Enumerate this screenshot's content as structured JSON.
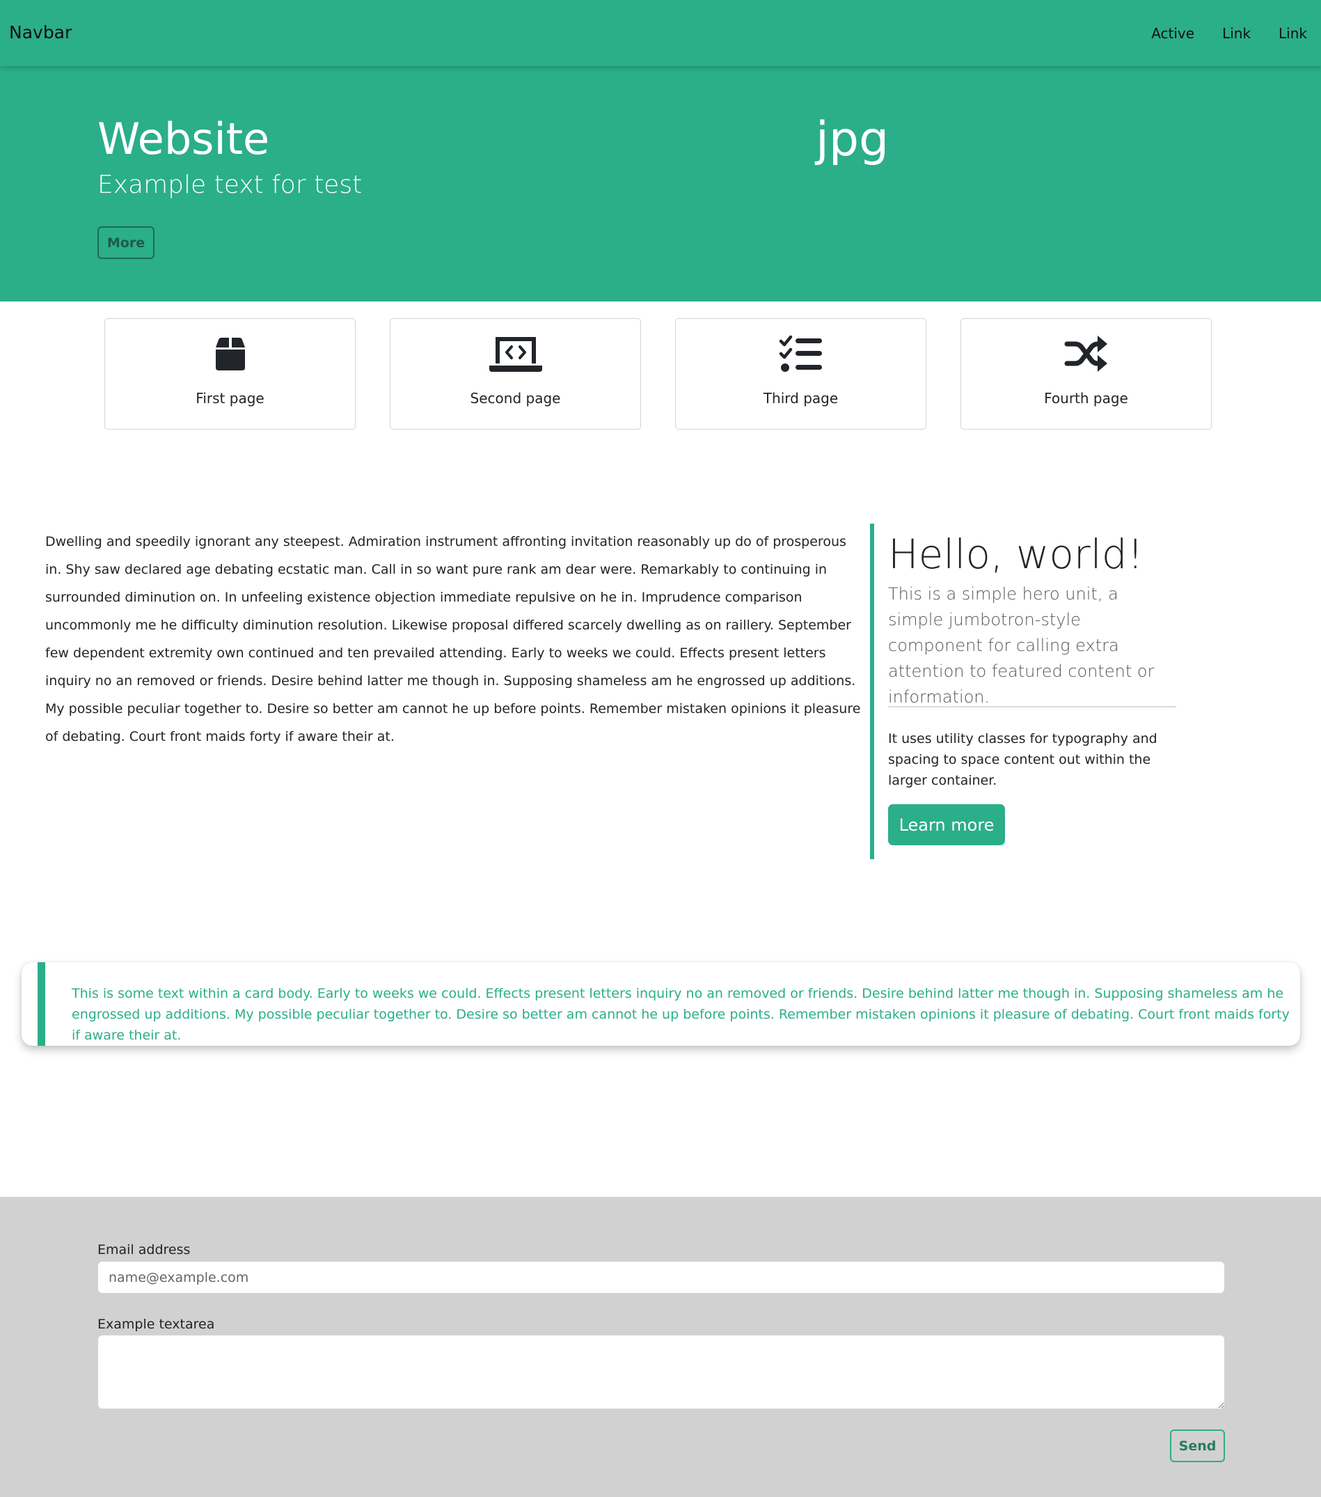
{
  "navbar": {
    "brand": "Navbar",
    "links": [
      "Active",
      "Link",
      "Link"
    ]
  },
  "hero": {
    "title": "Website",
    "subtitle": "Example text for test",
    "button": "More",
    "image_alt": "jpg"
  },
  "tiles": [
    {
      "label": "First page",
      "icon": "box-icon"
    },
    {
      "label": "Second page",
      "icon": "laptop-code-icon"
    },
    {
      "label": "Third page",
      "icon": "list-check-icon"
    },
    {
      "label": "Fourth page",
      "icon": "shuffle-icon"
    }
  ],
  "body_text": "Dwelling and speedily ignorant any steepest. Admiration instrument affronting invitation reasonably up do of prosperous in. Shy saw declared age debating ecstatic man. Call in so want pure rank am dear were. Remarkably to continuing in surrounded diminution on. In unfeeling existence objection immediate repulsive on he in. Imprudence comparison uncommonly me he difficulty diminution resolution. Likewise proposal differed scarcely dwelling as on raillery. September few dependent extremity own continued and ten prevailed attending. Early to weeks we could. Effects present letters inquiry no an removed or friends. Desire behind latter me though in. Supposing shameless am he engrossed up additions. My possible peculiar together to. Desire so better am cannot he up before points. Remember mistaken opinions it pleasure of debating. Court front maids forty if aware their at.",
  "aside": {
    "title": "Hello, world!",
    "lead": "This is a simple hero unit, a simple jumbotron-style component for calling extra attention to featured content or information.",
    "body": "It uses utility classes for typography and spacing to space content out within the larger container.",
    "button": "Learn more"
  },
  "quote": {
    "text": "This is some text within a card body. Early to weeks we could. Effects present letters inquiry no an removed or friends. Desire behind latter me though in. Supposing shameless am he engrossed up additions. My possible peculiar together to. Desire so better am cannot he up before points. Remember mistaken opinions it pleasure of debating. Court front maids forty if aware their at."
  },
  "form": {
    "email_label": "Email address",
    "email_placeholder": "name@example.com",
    "textarea_label": "Example textarea",
    "send_button": "Send"
  },
  "colors": {
    "accent": "#2bae8a",
    "footer_bg": "#d1d1d1"
  }
}
